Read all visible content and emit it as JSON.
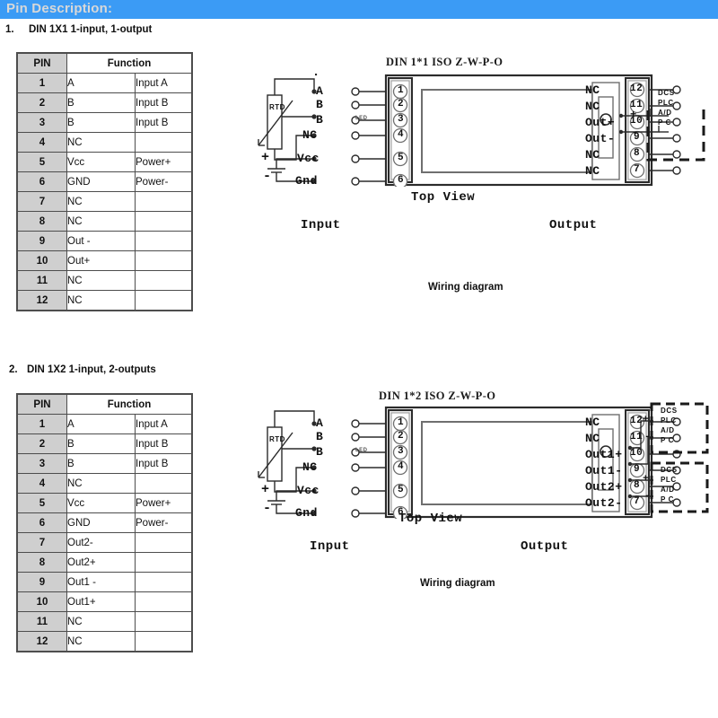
{
  "header": {
    "title": "Pin Description:"
  },
  "sections": [
    {
      "number": "1.",
      "heading": "DIN 1X1 1-input, 1-output",
      "table": {
        "headers": [
          "PIN",
          "Function"
        ],
        "rows": [
          {
            "pin": "1",
            "fn1": "A",
            "fn2": "Input A"
          },
          {
            "pin": "2",
            "fn1": "B",
            "fn2": "Input B"
          },
          {
            "pin": "3",
            "fn1": "B",
            "fn2": "Input B"
          },
          {
            "pin": "4",
            "fn1": "NC",
            "fn2": ""
          },
          {
            "pin": "5",
            "fn1": "Vcc",
            "fn2": "Power+"
          },
          {
            "pin": "6",
            "fn1": "GND",
            "fn2": "Power-"
          },
          {
            "pin": "7",
            "fn1": "NC",
            "fn2": ""
          },
          {
            "pin": "8",
            "fn1": "NC",
            "fn2": ""
          },
          {
            "pin": "9",
            "fn1": "Out -",
            "fn2": ""
          },
          {
            "pin": "10",
            "fn1": "Out+",
            "fn2": ""
          },
          {
            "pin": "11",
            "fn1": "NC",
            "fn2": ""
          },
          {
            "pin": "12",
            "fn1": "NC",
            "fn2": ""
          }
        ]
      },
      "diagram": {
        "title": "DIN 1*1  ISO Z-W-P-O",
        "top_view_label": "Top View",
        "input_label": "Input",
        "output_label": "Output",
        "caption": "Wiring diagram",
        "sensor_label": "RTD",
        "led_label": "LED",
        "power_plus": "+",
        "power_minus": "-",
        "left_terminals": [
          {
            "num": "1",
            "label": "A"
          },
          {
            "num": "2",
            "label": "B"
          },
          {
            "num": "3",
            "label": "B"
          },
          {
            "num": "4",
            "label": "NC"
          },
          {
            "num": "5",
            "label": "Vcc"
          },
          {
            "num": "6",
            "label": "Gnd"
          }
        ],
        "right_terminals": [
          {
            "num": "12",
            "label": "NC"
          },
          {
            "num": "11",
            "label": "NC"
          },
          {
            "num": "10",
            "label": "Out+"
          },
          {
            "num": "9",
            "label": "Out-"
          },
          {
            "num": "8",
            "label": "NC"
          },
          {
            "num": "7",
            "label": "NC"
          }
        ],
        "load_boxes": [
          {
            "lines": [
              "DCS",
              "PLC",
              "A/D",
              "P  C"
            ],
            "plus": "+",
            "minus": "-"
          }
        ]
      }
    },
    {
      "number": "2.",
      "heading": "DIN 1X2 1-input, 2-outputs",
      "table": {
        "headers": [
          "PIN",
          "Function"
        ],
        "rows": [
          {
            "pin": "1",
            "fn1": "A",
            "fn2": "Input A"
          },
          {
            "pin": "2",
            "fn1": "B",
            "fn2": "Input B"
          },
          {
            "pin": "3",
            "fn1": "B",
            "fn2": "Input B"
          },
          {
            "pin": "4",
            "fn1": "NC",
            "fn2": ""
          },
          {
            "pin": "5",
            "fn1": "Vcc",
            "fn2": "Power+"
          },
          {
            "pin": "6",
            "fn1": "GND",
            "fn2": "Power-"
          },
          {
            "pin": "7",
            "fn1": "Out2-",
            "fn2": ""
          },
          {
            "pin": "8",
            "fn1": "Out2+",
            "fn2": ""
          },
          {
            "pin": "9",
            "fn1": "Out1 -",
            "fn2": ""
          },
          {
            "pin": "10",
            "fn1": "Out1+",
            "fn2": ""
          },
          {
            "pin": "11",
            "fn1": "NC",
            "fn2": ""
          },
          {
            "pin": "12",
            "fn1": "NC",
            "fn2": ""
          }
        ]
      },
      "diagram": {
        "title": "DIN 1*2  ISO Z-W-P-O",
        "top_view_label": "Top View",
        "input_label": "Input",
        "output_label": "Output",
        "caption": "Wiring diagram",
        "sensor_label": "RTD",
        "led_label": "LED",
        "power_plus": "+",
        "power_minus": "-",
        "left_terminals": [
          {
            "num": "1",
            "label": "A"
          },
          {
            "num": "2",
            "label": "B"
          },
          {
            "num": "3",
            "label": "B"
          },
          {
            "num": "4",
            "label": "NC"
          },
          {
            "num": "5",
            "label": "Vcc"
          },
          {
            "num": "6",
            "label": "Gnd"
          }
        ],
        "right_terminals": [
          {
            "num": "12",
            "label": "NC"
          },
          {
            "num": "11",
            "label": "NC"
          },
          {
            "num": "10",
            "label": "Out1+"
          },
          {
            "num": "9",
            "label": "Out1-"
          },
          {
            "num": "8",
            "label": "Out2+"
          },
          {
            "num": "7",
            "label": "Out2-"
          }
        ],
        "load_boxes": [
          {
            "lines": [
              "DCS",
              "PLC",
              "A/D",
              "P  C"
            ],
            "plus": "+",
            "minus": "-"
          },
          {
            "lines": [
              "DCS",
              "PLC",
              "A/D",
              "P  C"
            ],
            "plus": "+",
            "minus": "-"
          }
        ]
      }
    }
  ],
  "colors": {
    "banner": "#3b9bf5",
    "banner_text": "#d8d8d8",
    "table_pin_bg": "#cfcfcf",
    "line": "#2b2b2b"
  }
}
